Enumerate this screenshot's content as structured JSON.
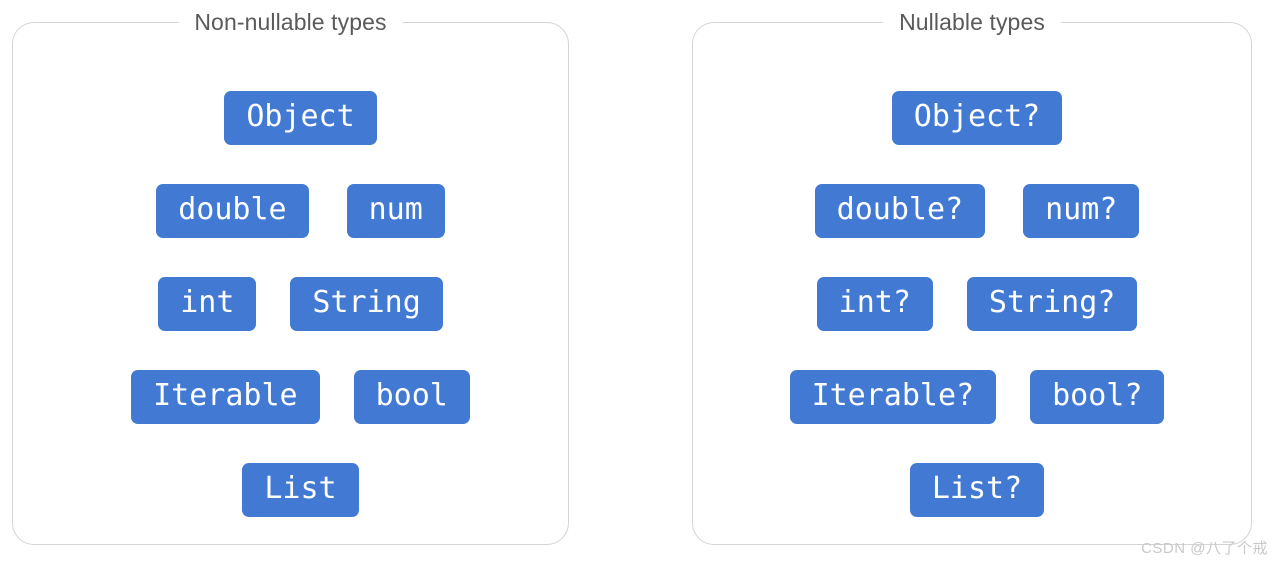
{
  "colors": {
    "chip_fill": "#4179d3",
    "chip_text": "#ffffff",
    "panel_border": "#d4d4d4",
    "title_text": "#5a5a5a",
    "background": "#ffffff",
    "watermark_text": "#c9c9c9"
  },
  "panels": [
    {
      "id": "non-nullable",
      "title": "Non-nullable types",
      "rows": [
        {
          "chips": [
            "Object"
          ]
        },
        {
          "chips": [
            "double",
            "num"
          ]
        },
        {
          "chips": [
            "int",
            "String"
          ]
        },
        {
          "chips": [
            "Iterable",
            "bool"
          ]
        },
        {
          "chips": [
            "List"
          ]
        }
      ]
    },
    {
      "id": "nullable",
      "title": "Nullable types",
      "rows": [
        {
          "chips": [
            "Object?"
          ]
        },
        {
          "chips": [
            "double?",
            "num?"
          ]
        },
        {
          "chips": [
            "int?",
            "String?"
          ]
        },
        {
          "chips": [
            "Iterable?",
            "bool?"
          ]
        },
        {
          "chips": [
            "List?"
          ]
        }
      ]
    }
  ],
  "watermark": {
    "text": "CSDN @八了个戒"
  }
}
